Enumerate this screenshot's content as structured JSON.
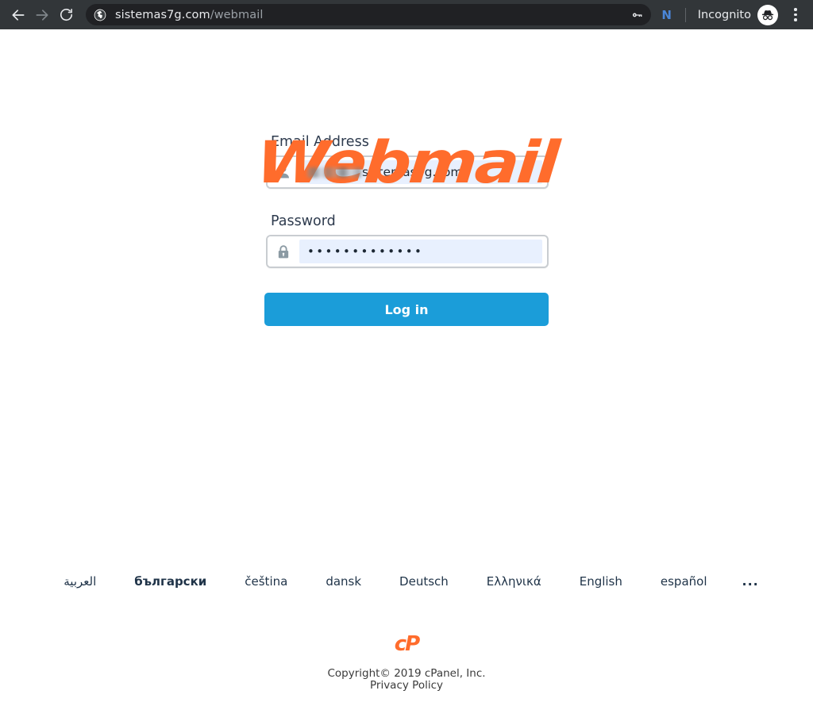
{
  "browser": {
    "back_icon": "back-arrow-icon",
    "forward_icon": "forward-arrow-icon",
    "reload_icon": "reload-icon",
    "site_icon": "globe-icon",
    "url_host": "sistemas7g.com",
    "url_path": "/webmail",
    "password_manager_icon": "key-icon",
    "extension_label": "N",
    "profile_label": "Incognito",
    "profile_icon": "incognito-hat-icon",
    "menu_icon": "three-dot-menu-icon"
  },
  "page": {
    "logo_text": "Webmail",
    "email": {
      "label": "Email Address",
      "icon": "user-icon",
      "value_redacted": true,
      "value_suffix": "sistemas7g.com"
    },
    "password": {
      "label": "Password",
      "icon": "lock-icon",
      "value_dots": "•••••••••••••"
    },
    "login_button": "Log in",
    "locales": [
      {
        "label": "العربية",
        "bold": false
      },
      {
        "label": "български",
        "bold": true
      },
      {
        "label": "čeština",
        "bold": false
      },
      {
        "label": "dansk",
        "bold": false
      },
      {
        "label": "Deutsch",
        "bold": false
      },
      {
        "label": "Ελληνικά",
        "bold": false
      },
      {
        "label": "English",
        "bold": false
      },
      {
        "label": "español",
        "bold": false
      }
    ],
    "locales_more": "...",
    "footer": {
      "brand_logo": "cP",
      "copyright": "Copyright© 2019 cPanel, Inc.",
      "privacy_policy": "Privacy Policy"
    }
  },
  "colors": {
    "brand_orange": "#ff6c2c",
    "login_blue": "#1b9dd9",
    "toolbar_dark": "#323639",
    "omnibox_dark": "#202124",
    "autofill_blue": "#e8f0fe"
  }
}
